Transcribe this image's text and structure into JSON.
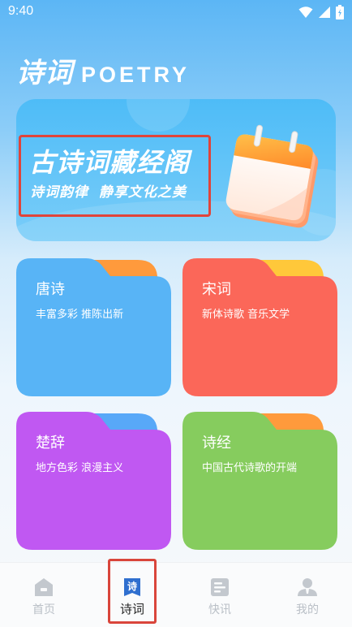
{
  "status_bar": {
    "time": "9:40",
    "icons": [
      "wifi-icon",
      "signal-icon",
      "battery-icon"
    ]
  },
  "header": {
    "title_cn": "诗词",
    "title_en": "POETRY"
  },
  "banner": {
    "title": "古诗词藏经阁",
    "subtitle": "诗词韵律 静享文化之美",
    "illustration": "calendar-icon"
  },
  "categories": [
    {
      "title": "唐诗",
      "desc": "丰富多彩 推陈出新",
      "color_main": "#58b4f6",
      "color_tab": "#ff9a3c"
    },
    {
      "title": "宋词",
      "desc": "新体诗歌 音乐文学",
      "color_main": "#fb6759",
      "color_tab": "#ffc83a"
    },
    {
      "title": "楚辞",
      "desc": "地方色彩 浪漫主义",
      "color_main": "#c058f2",
      "color_tab": "#58a8f8"
    },
    {
      "title": "诗经",
      "desc": "中国古代诗歌的开端",
      "color_main": "#86cc5e",
      "color_tab": "#ff9a3c"
    }
  ],
  "bottom_nav": {
    "active_index": 1,
    "items": [
      {
        "label": "首页",
        "icon": "home-icon"
      },
      {
        "label": "诗词",
        "icon": "poem-icon",
        "icon_char": "诗"
      },
      {
        "label": "快讯",
        "icon": "news-icon"
      },
      {
        "label": "我的",
        "icon": "user-icon"
      }
    ]
  },
  "colors": {
    "highlight_border": "#e0443a",
    "nav_inactive": "#b9bfc6",
    "nav_active_icon": "#2f6fcf"
  }
}
